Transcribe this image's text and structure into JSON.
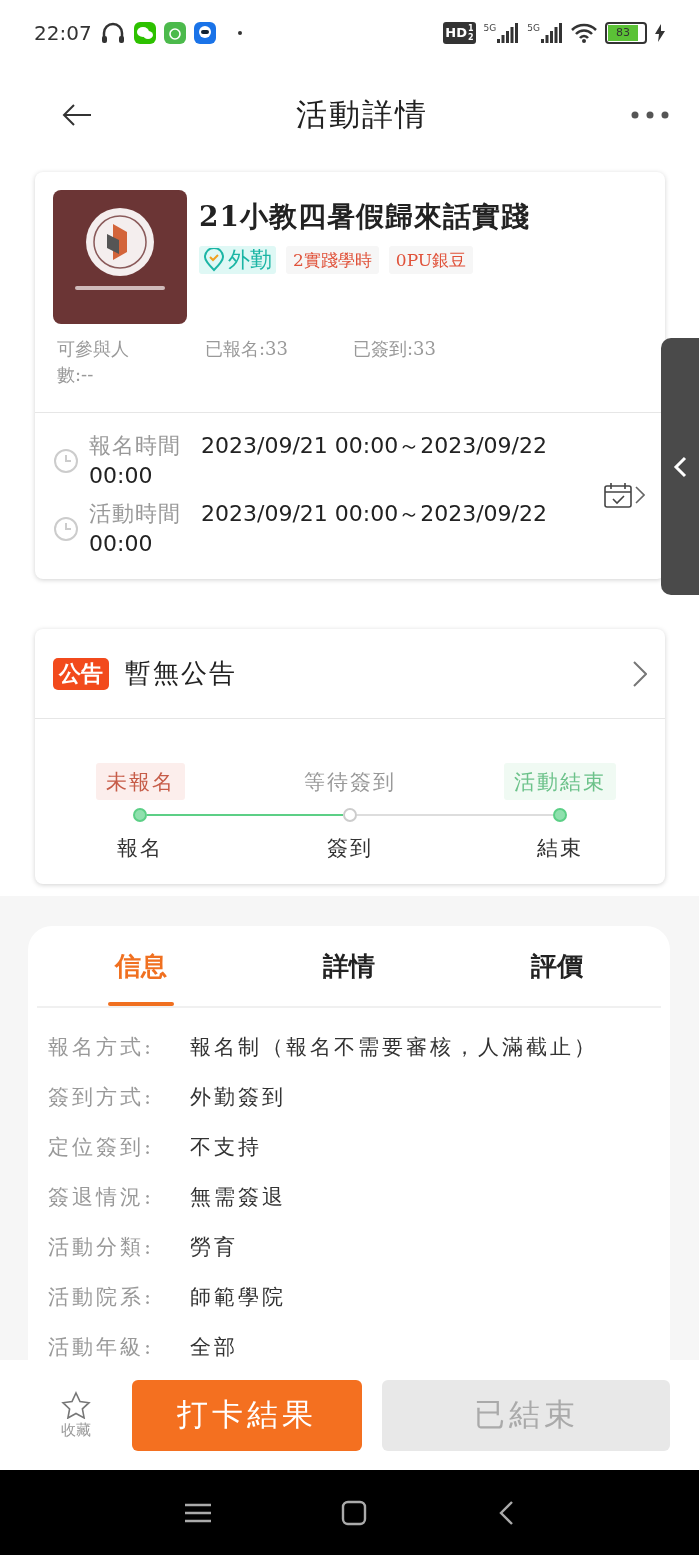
{
  "status_bar": {
    "time": "22:07",
    "hd_badge": "HD",
    "hd_slots": [
      "1",
      "2"
    ],
    "networks": [
      "5G",
      "5G"
    ],
    "battery": "83",
    "charging": true
  },
  "header": {
    "title": "活動詳情"
  },
  "activity": {
    "title": "21小教四暑假歸來話實踐",
    "tags": [
      {
        "kind": "checkin",
        "label": "外勤"
      },
      {
        "kind": "plain",
        "label": "2實踐學時"
      },
      {
        "kind": "plain",
        "label": "0PU銀豆"
      }
    ],
    "stats": [
      "可參與人數:--",
      "已報名:33",
      "已簽到:33"
    ],
    "times": [
      {
        "label": "報名時間",
        "value": "2023/09/21 00:00～2023/09/22 00:00"
      },
      {
        "label": "活動時間",
        "value": "2023/09/21 00:00～2023/09/22 00:00"
      }
    ]
  },
  "notice": {
    "badge": "公告",
    "text": "暫無公告"
  },
  "progress": [
    {
      "tag": "未報名",
      "kind": "red",
      "step": "報名",
      "done": true
    },
    {
      "tag": "等待簽到",
      "kind": "plain",
      "step": "簽到",
      "done": false
    },
    {
      "tag": "活動結束",
      "kind": "green",
      "step": "結束",
      "done": true
    }
  ],
  "tabs": [
    {
      "label": "信息",
      "selected": true
    },
    {
      "label": "詳情",
      "selected": false
    },
    {
      "label": "評價",
      "selected": false
    }
  ],
  "info_rows": [
    {
      "label": "報名方式:",
      "value": "報名制（報名不需要審核，人滿截止）"
    },
    {
      "label": "簽到方式:",
      "value": "外勤簽到"
    },
    {
      "label": "定位簽到:",
      "value": "不支持"
    },
    {
      "label": "簽退情況:",
      "value": "無需簽退"
    },
    {
      "label": "活動分類:",
      "value": "勞育"
    },
    {
      "label": "活動院系:",
      "value": "師範學院"
    },
    {
      "label": "活動年級:",
      "value": "全部"
    }
  ],
  "bottom_bar": {
    "favorite": "收藏",
    "buttons": [
      {
        "label": "打卡結果",
        "disabled": false
      },
      {
        "label": "已結束",
        "disabled": true
      }
    ]
  }
}
